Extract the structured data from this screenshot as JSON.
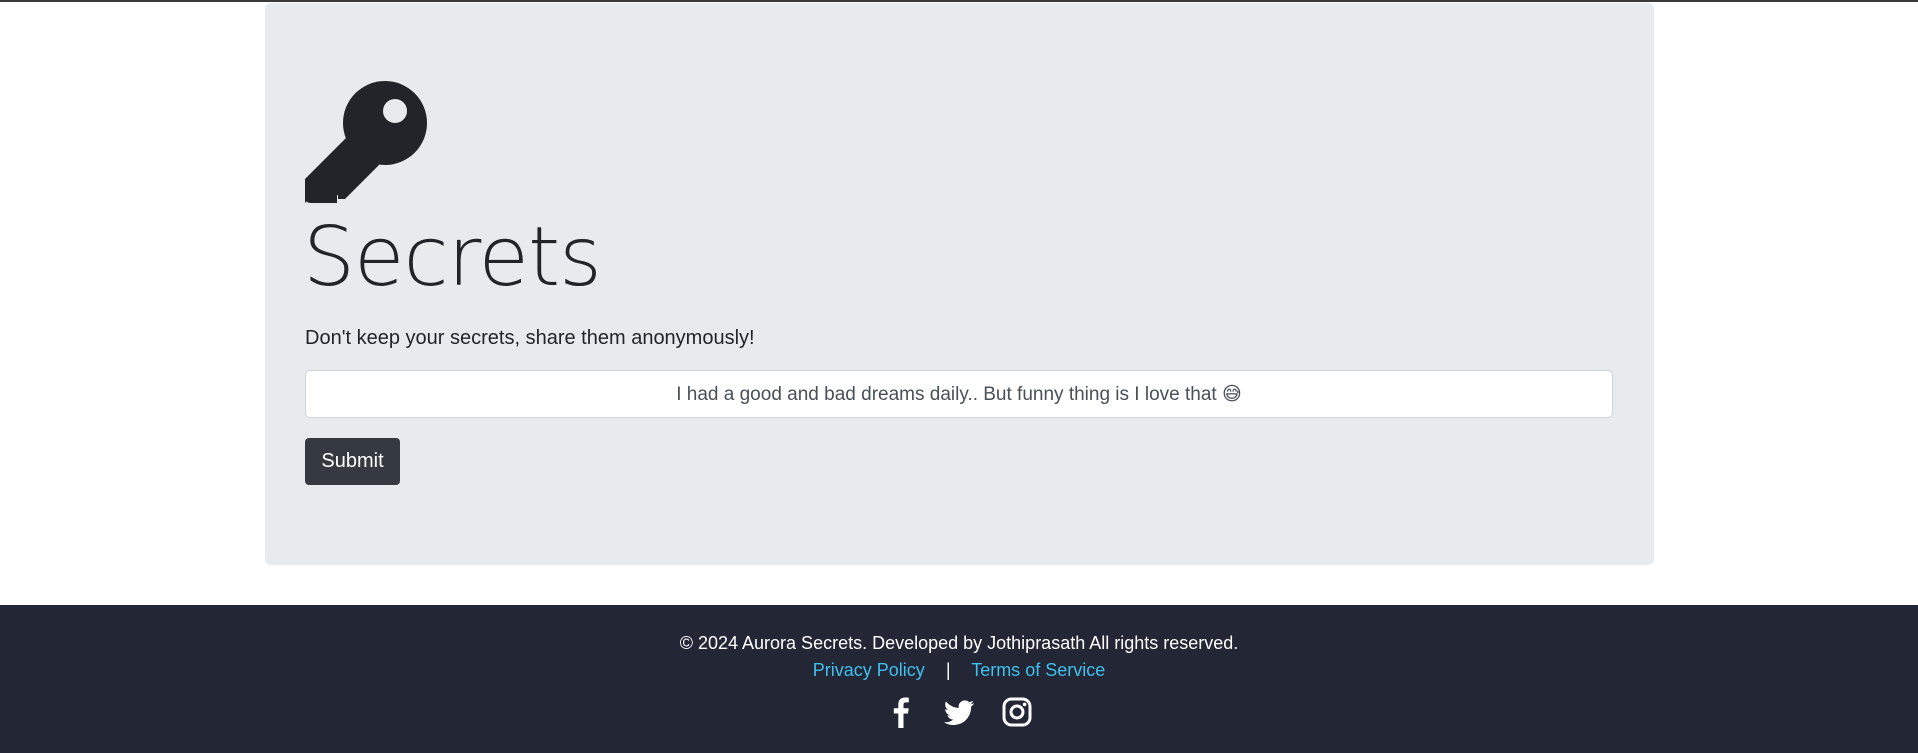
{
  "hero": {
    "icon": "key-icon",
    "title": "Secrets",
    "subtitle": "Don't keep your secrets, share them anonymously!"
  },
  "form": {
    "input_value": "I had a good and bad dreams daily.. But funny thing is I love that 😅",
    "submit_label": "Submit"
  },
  "footer": {
    "copyright": "© 2024 Aurora Secrets. Developed by Jothiprasath All rights reserved.",
    "privacy_label": "Privacy Policy",
    "separator": "|",
    "terms_label": "Terms of Service",
    "social_icons": [
      "facebook-icon",
      "twitter-icon",
      "instagram-icon"
    ]
  },
  "colors": {
    "jumbotron_bg": "#e8ebee",
    "button_bg": "#343a40",
    "footer_bg": "#222635",
    "link": "#3ec1f0",
    "text": "#212529"
  }
}
